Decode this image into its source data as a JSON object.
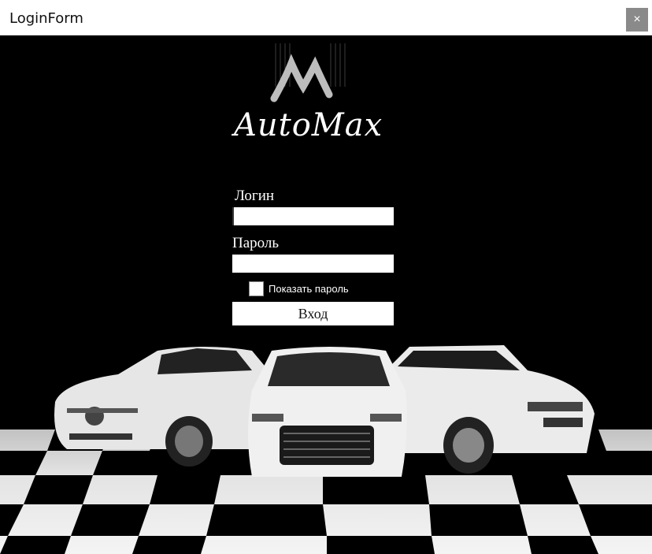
{
  "window": {
    "title": "LoginForm",
    "close_glyph": "×"
  },
  "logo": {
    "text": "AutoMax",
    "icon": "automax-logo-icon"
  },
  "form": {
    "login_label": "Логин",
    "login_value": "",
    "password_label": "Пароль",
    "password_value": "",
    "show_password_label": "Показать пароль",
    "show_password_checked": false,
    "submit_label": "Вход"
  }
}
